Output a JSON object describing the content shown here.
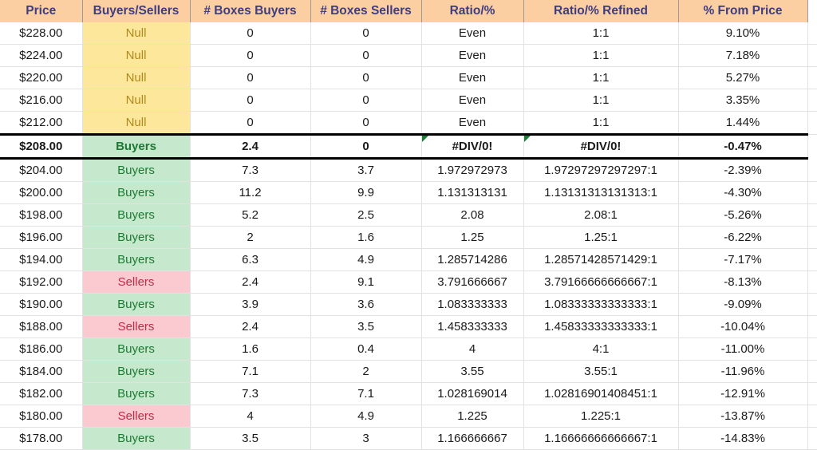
{
  "sheet": {
    "columns": [
      {
        "key": "price",
        "label": "Price"
      },
      {
        "key": "bs",
        "label": "Buyers/Sellers"
      },
      {
        "key": "boxes_buy",
        "label": "# Boxes Buyers"
      },
      {
        "key": "boxes_sell",
        "label": "# Boxes Sellers"
      },
      {
        "key": "ratio",
        "label": "Ratio/%"
      },
      {
        "key": "ratio_ref",
        "label": "Ratio/% Refined"
      },
      {
        "key": "pct",
        "label": "% From Price"
      }
    ],
    "colors": {
      "header_fill": "#FBCFA2",
      "header_text": "#3F3D80",
      "null_fill": "#FCE79B",
      "null_text": "#B08A1E",
      "buyers_fill": "#C6E8CD",
      "buyers_text": "#1D7A33",
      "sellers_fill": "#FBC9D0",
      "sellers_text": "#C22A47",
      "error_triangle": "#1E7B34",
      "highlight_border": "#000000"
    },
    "rows": [
      {
        "price": "$228.00",
        "bs": "Null",
        "cat": "null",
        "boxes_buy": "0",
        "boxes_sell": "0",
        "ratio": "Even",
        "ratio_ref": "1:1",
        "pct": "9.10%",
        "highlight": false,
        "error": false
      },
      {
        "price": "$224.00",
        "bs": "Null",
        "cat": "null",
        "boxes_buy": "0",
        "boxes_sell": "0",
        "ratio": "Even",
        "ratio_ref": "1:1",
        "pct": "7.18%",
        "highlight": false,
        "error": false
      },
      {
        "price": "$220.00",
        "bs": "Null",
        "cat": "null",
        "boxes_buy": "0",
        "boxes_sell": "0",
        "ratio": "Even",
        "ratio_ref": "1:1",
        "pct": "5.27%",
        "highlight": false,
        "error": false
      },
      {
        "price": "$216.00",
        "bs": "Null",
        "cat": "null",
        "boxes_buy": "0",
        "boxes_sell": "0",
        "ratio": "Even",
        "ratio_ref": "1:1",
        "pct": "3.35%",
        "highlight": false,
        "error": false
      },
      {
        "price": "$212.00",
        "bs": "Null",
        "cat": "null",
        "boxes_buy": "0",
        "boxes_sell": "0",
        "ratio": "Even",
        "ratio_ref": "1:1",
        "pct": "1.44%",
        "highlight": false,
        "error": false
      },
      {
        "price": "$208.00",
        "bs": "Buyers",
        "cat": "buyers",
        "boxes_buy": "2.4",
        "boxes_sell": "0",
        "ratio": "#DIV/0!",
        "ratio_ref": "#DIV/0!",
        "pct": "-0.47%",
        "highlight": true,
        "error": true
      },
      {
        "price": "$204.00",
        "bs": "Buyers",
        "cat": "buyers",
        "boxes_buy": "7.3",
        "boxes_sell": "3.7",
        "ratio": "1.972972973",
        "ratio_ref": "1.97297297297297:1",
        "pct": "-2.39%",
        "highlight": false,
        "error": false
      },
      {
        "price": "$200.00",
        "bs": "Buyers",
        "cat": "buyers",
        "boxes_buy": "11.2",
        "boxes_sell": "9.9",
        "ratio": "1.131313131",
        "ratio_ref": "1.13131313131313:1",
        "pct": "-4.30%",
        "highlight": false,
        "error": false
      },
      {
        "price": "$198.00",
        "bs": "Buyers",
        "cat": "buyers",
        "boxes_buy": "5.2",
        "boxes_sell": "2.5",
        "ratio": "2.08",
        "ratio_ref": "2.08:1",
        "pct": "-5.26%",
        "highlight": false,
        "error": false
      },
      {
        "price": "$196.00",
        "bs": "Buyers",
        "cat": "buyers",
        "boxes_buy": "2",
        "boxes_sell": "1.6",
        "ratio": "1.25",
        "ratio_ref": "1.25:1",
        "pct": "-6.22%",
        "highlight": false,
        "error": false
      },
      {
        "price": "$194.00",
        "bs": "Buyers",
        "cat": "buyers",
        "boxes_buy": "6.3",
        "boxes_sell": "4.9",
        "ratio": "1.285714286",
        "ratio_ref": "1.28571428571429:1",
        "pct": "-7.17%",
        "highlight": false,
        "error": false
      },
      {
        "price": "$192.00",
        "bs": "Sellers",
        "cat": "sellers",
        "boxes_buy": "2.4",
        "boxes_sell": "9.1",
        "ratio": "3.791666667",
        "ratio_ref": "3.79166666666667:1",
        "pct": "-8.13%",
        "highlight": false,
        "error": false
      },
      {
        "price": "$190.00",
        "bs": "Buyers",
        "cat": "buyers",
        "boxes_buy": "3.9",
        "boxes_sell": "3.6",
        "ratio": "1.083333333",
        "ratio_ref": "1.08333333333333:1",
        "pct": "-9.09%",
        "highlight": false,
        "error": false
      },
      {
        "price": "$188.00",
        "bs": "Sellers",
        "cat": "sellers",
        "boxes_buy": "2.4",
        "boxes_sell": "3.5",
        "ratio": "1.458333333",
        "ratio_ref": "1.45833333333333:1",
        "pct": "-10.04%",
        "highlight": false,
        "error": false
      },
      {
        "price": "$186.00",
        "bs": "Buyers",
        "cat": "buyers",
        "boxes_buy": "1.6",
        "boxes_sell": "0.4",
        "ratio": "4",
        "ratio_ref": "4:1",
        "pct": "-11.00%",
        "highlight": false,
        "error": false
      },
      {
        "price": "$184.00",
        "bs": "Buyers",
        "cat": "buyers",
        "boxes_buy": "7.1",
        "boxes_sell": "2",
        "ratio": "3.55",
        "ratio_ref": "3.55:1",
        "pct": "-11.96%",
        "highlight": false,
        "error": false
      },
      {
        "price": "$182.00",
        "bs": "Buyers",
        "cat": "buyers",
        "boxes_buy": "7.3",
        "boxes_sell": "7.1",
        "ratio": "1.028169014",
        "ratio_ref": "1.02816901408451:1",
        "pct": "-12.91%",
        "highlight": false,
        "error": false
      },
      {
        "price": "$180.00",
        "bs": "Sellers",
        "cat": "sellers",
        "boxes_buy": "4",
        "boxes_sell": "4.9",
        "ratio": "1.225",
        "ratio_ref": "1.225:1",
        "pct": "-13.87%",
        "highlight": false,
        "error": false
      },
      {
        "price": "$178.00",
        "bs": "Buyers",
        "cat": "buyers",
        "boxes_buy": "3.5",
        "boxes_sell": "3",
        "ratio": "1.166666667",
        "ratio_ref": "1.16666666666667:1",
        "pct": "-14.83%",
        "highlight": false,
        "error": false
      }
    ]
  }
}
